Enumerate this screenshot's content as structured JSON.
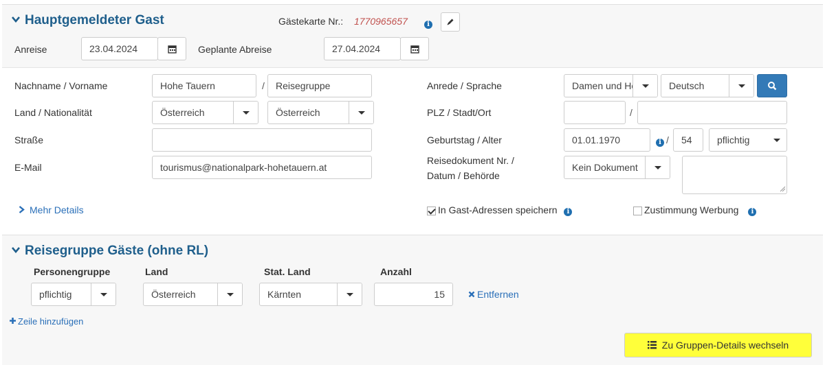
{
  "main_guest": {
    "title": "Hauptgemeldeter Gast",
    "guest_card_label": "Gästekarte Nr.:",
    "guest_card_number": "1770965657",
    "arrival_label": "Anreise",
    "arrival_value": "23.04.2024",
    "departure_label": "Geplante Abreise",
    "departure_value": "27.04.2024"
  },
  "form": {
    "name_label": "Nachname / Vorname",
    "last_name": "Hohe Tauern",
    "first_name": "Reisegruppe",
    "country_label": "Land / Nationalität",
    "country": "Österreich",
    "nationality": "Österreich",
    "street_label": "Straße",
    "street": "",
    "email_label": "E-Mail",
    "email": "tourismus@nationalpark-hohetauern.at",
    "salutation_label": "Anrede / Sprache",
    "salutation": "Damen und Herren",
    "language": "Deutsch",
    "zip_label": "PLZ / Stadt/Ort",
    "zip": "",
    "city": "",
    "birthday_label": "Geburtstag / Alter",
    "birthday": "01.01.1970",
    "age": "54",
    "obligation": "pflichtig",
    "document_label_1": "Reisedokument Nr. /",
    "document_label_2": "Datum / Behörde",
    "document_type": "Kein Dokument",
    "document_notes": "",
    "slash": "/",
    "more_details": "Mehr Details",
    "save_address_label": "In Gast-Adressen speichern",
    "save_address_checked": true,
    "consent_label": "Zustimmung Werbung",
    "consent_checked": false
  },
  "group": {
    "title": "Reisegruppe Gäste (ohne RL)",
    "columns": [
      "Personengruppe",
      "Land",
      "Stat. Land",
      "Anzahl"
    ],
    "row": {
      "person_group": "pflichtig",
      "country": "Österreich",
      "stat_country": "Kärnten",
      "count": "15",
      "remove": "Entfernen"
    },
    "add_row": "Zeile hinzufügen",
    "switch_button": "Zu Gruppen-Details wechseln"
  },
  "colors": {
    "title": "#1f5f8c",
    "link": "#2a6fb8",
    "search_button": "#337ab7",
    "guest_card_number": "#c0504d",
    "highlight": "#ffff3a"
  }
}
